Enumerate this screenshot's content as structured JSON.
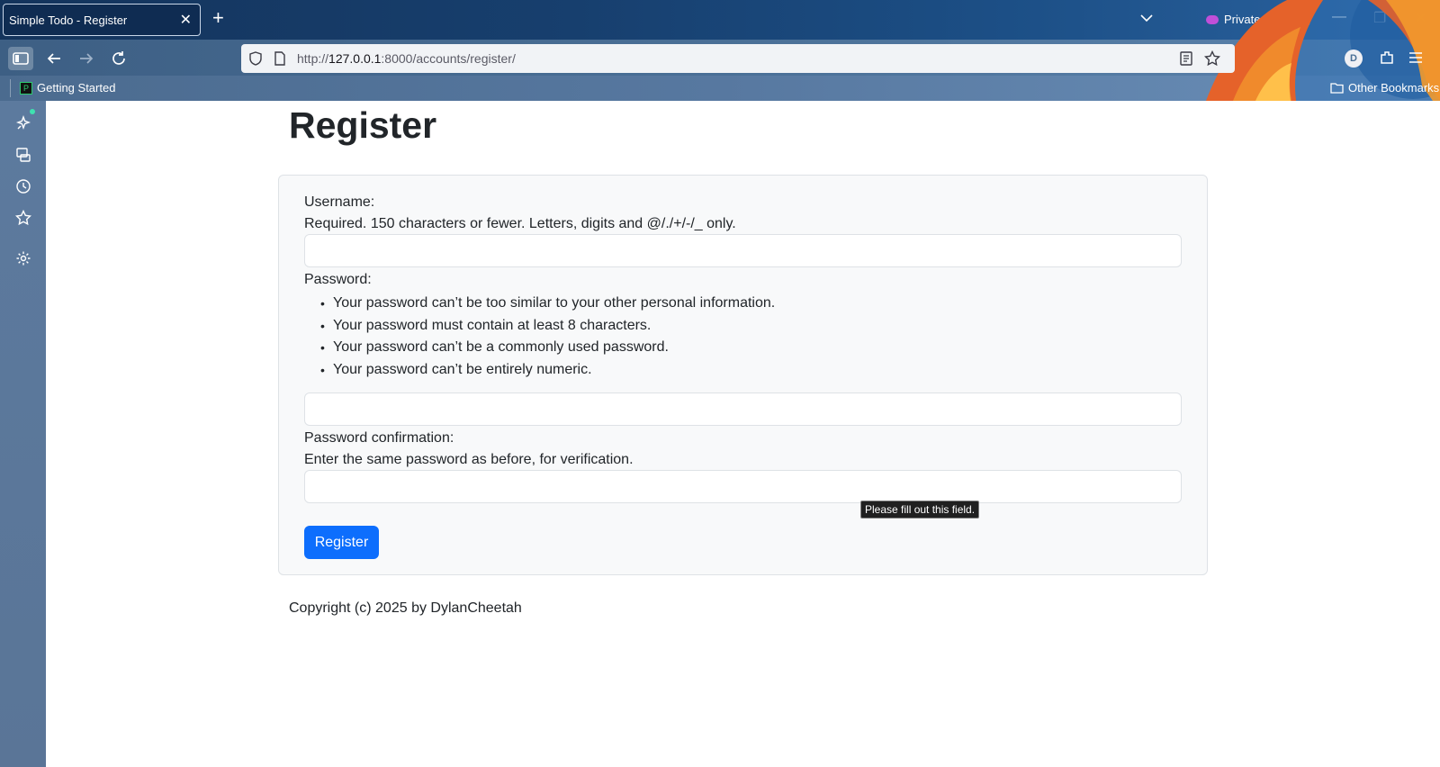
{
  "browser": {
    "tab_title": "Simple Todo - Register",
    "tab_close": "✕",
    "new_tab": "+",
    "private_label": "Private browsing",
    "window_min": "—",
    "window_restore": "❐",
    "window_close": "✕",
    "url_scheme": "http://",
    "url_host": "127.0.0.1",
    "url_path": ":8000/accounts/register/",
    "profile_initial": "D",
    "bookmark_item": "Getting Started",
    "bookmark_favicon": "P",
    "other_bookmarks": "Other Bookmarks"
  },
  "sidebar": {
    "icons": [
      "ai-chatbot-icon",
      "synced-tabs-icon",
      "history-icon",
      "bookmarks-icon",
      "settings-icon"
    ]
  },
  "page": {
    "title": "Register",
    "username_label": "Username:",
    "username_help": "Required. 150 characters or fewer. Letters, digits and @/./+/-/_ only.",
    "password_label": "Password:",
    "password_rules": [
      "Your password can’t be too similar to your other personal information.",
      "Your password must contain at least 8 characters.",
      "Your password can’t be a commonly used password.",
      "Your password can’t be entirely numeric."
    ],
    "password_confirm_label": "Password confirmation:",
    "password_confirm_help": "Enter the same password as before, for verification.",
    "submit_label": "Register",
    "validation_tooltip": "Please fill out this field.",
    "footer": "Copyright (c) 2025 by DylanCheetah"
  },
  "colors": {
    "primary_button": "#0d6efd",
    "card_background": "#f8f9fa",
    "private_accent": "#c04fd8"
  }
}
